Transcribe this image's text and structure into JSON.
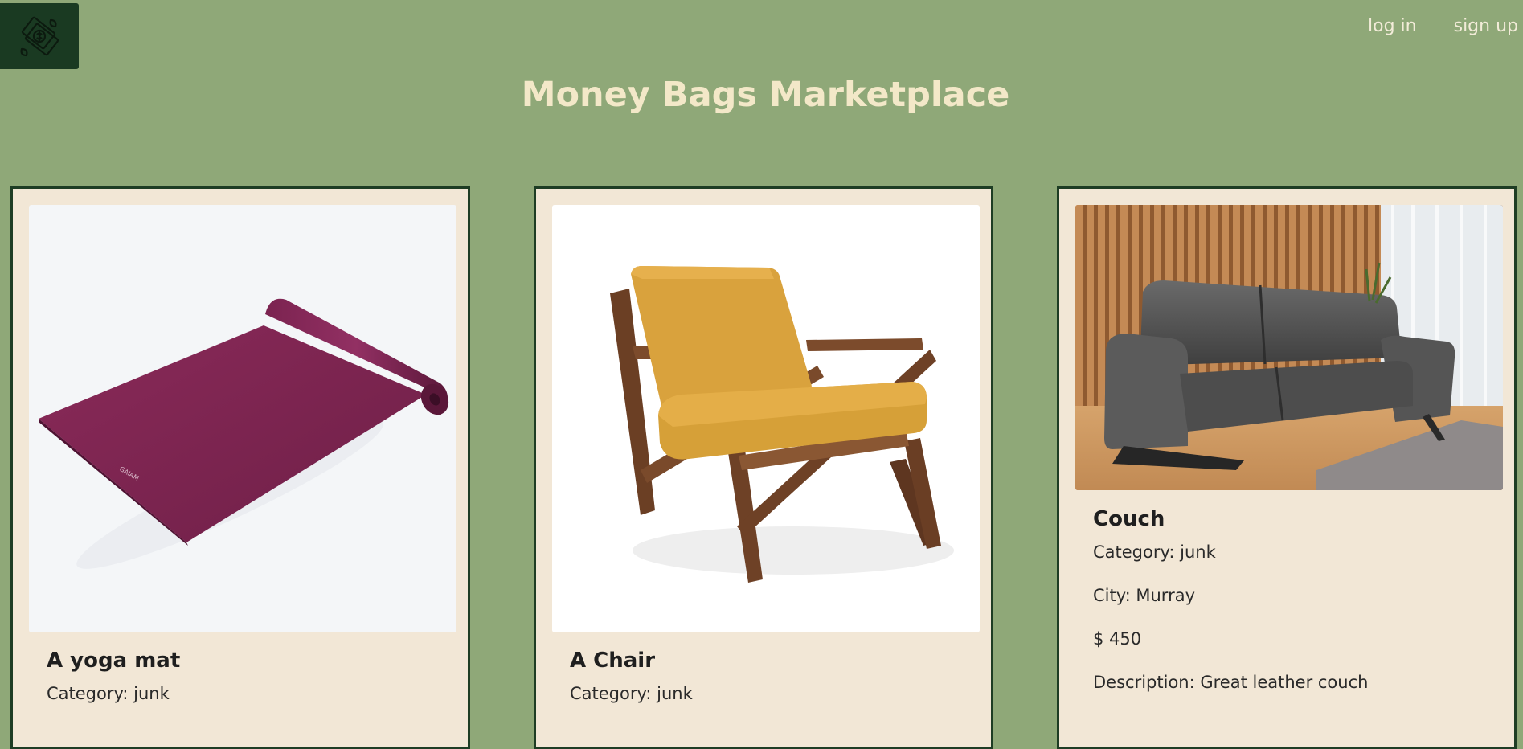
{
  "header": {
    "logo_icon": "money-bag-icon",
    "nav": {
      "login": "log in",
      "signup": "sign up"
    },
    "title": "Money Bags Marketplace"
  },
  "colors": {
    "background": "#8fa878",
    "card": "#f2e7d6",
    "border": "#1e3d24",
    "title": "#f3e8c8"
  },
  "listings": [
    {
      "title": "A yoga mat",
      "category": "Category: junk",
      "image": "yoga-mat-image"
    },
    {
      "title": "A Chair",
      "category": "Category: junk",
      "image": "chair-image"
    },
    {
      "title": "Couch",
      "category": "Category: junk",
      "city": "City: Murray",
      "price": "$ 450",
      "description": "Description: Great leather couch",
      "image": "couch-image"
    }
  ]
}
